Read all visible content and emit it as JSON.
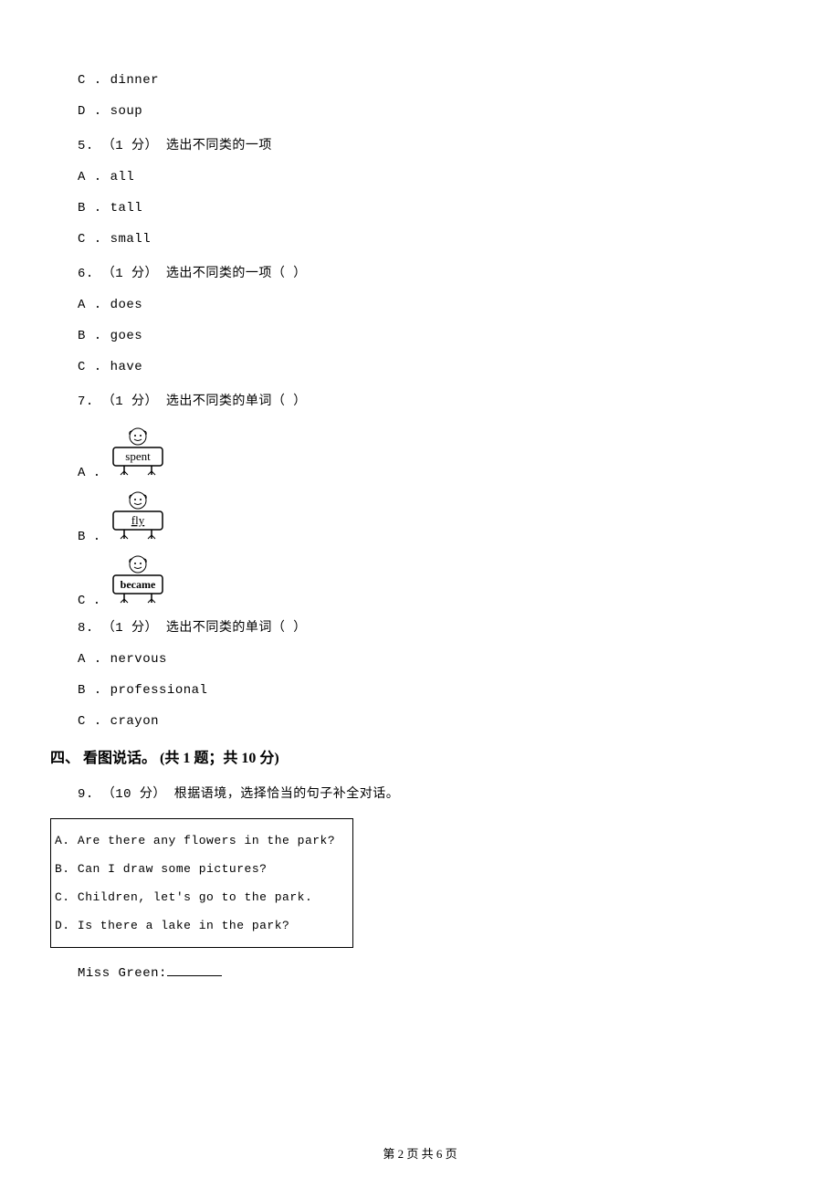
{
  "q_prev": {
    "c": "C . dinner",
    "d": "D . soup"
  },
  "q5": {
    "stem": "5. （1 分） 选出不同类的一项",
    "a": "A . all",
    "b": "B . tall",
    "c": "C . small"
  },
  "q6": {
    "stem": "6. （1 分） 选出不同类的一项（   ）",
    "a": "A . does",
    "b": "B . goes",
    "c": "C . have"
  },
  "q7": {
    "stem": "7. （1 分） 选出不同类的单词（   ）",
    "a_label": "A .",
    "b_label": "B .",
    "c_label": "C .",
    "a_word": "spent",
    "b_word": "fly",
    "c_word": "became"
  },
  "q8": {
    "stem": "8. （1 分） 选出不同类的单词（   ）",
    "a": "A . nervous",
    "b": "B . professional",
    "c": "C . crayon"
  },
  "section4": "四、 看图说话。 (共 1 题；共 10 分)",
  "q9": {
    "stem": "9. （10 分） 根据语境，选择恰当的句子补全对话。",
    "optA": "A. Are there any flowers in the park?",
    "optB": "B. Can I draw some pictures?",
    "optC": "C. Children, let's go to the park.",
    "optD": "D. Is there a lake in the park?",
    "dialog1_prefix": "Miss Green:"
  },
  "footer": "第 2 页 共 6 页"
}
